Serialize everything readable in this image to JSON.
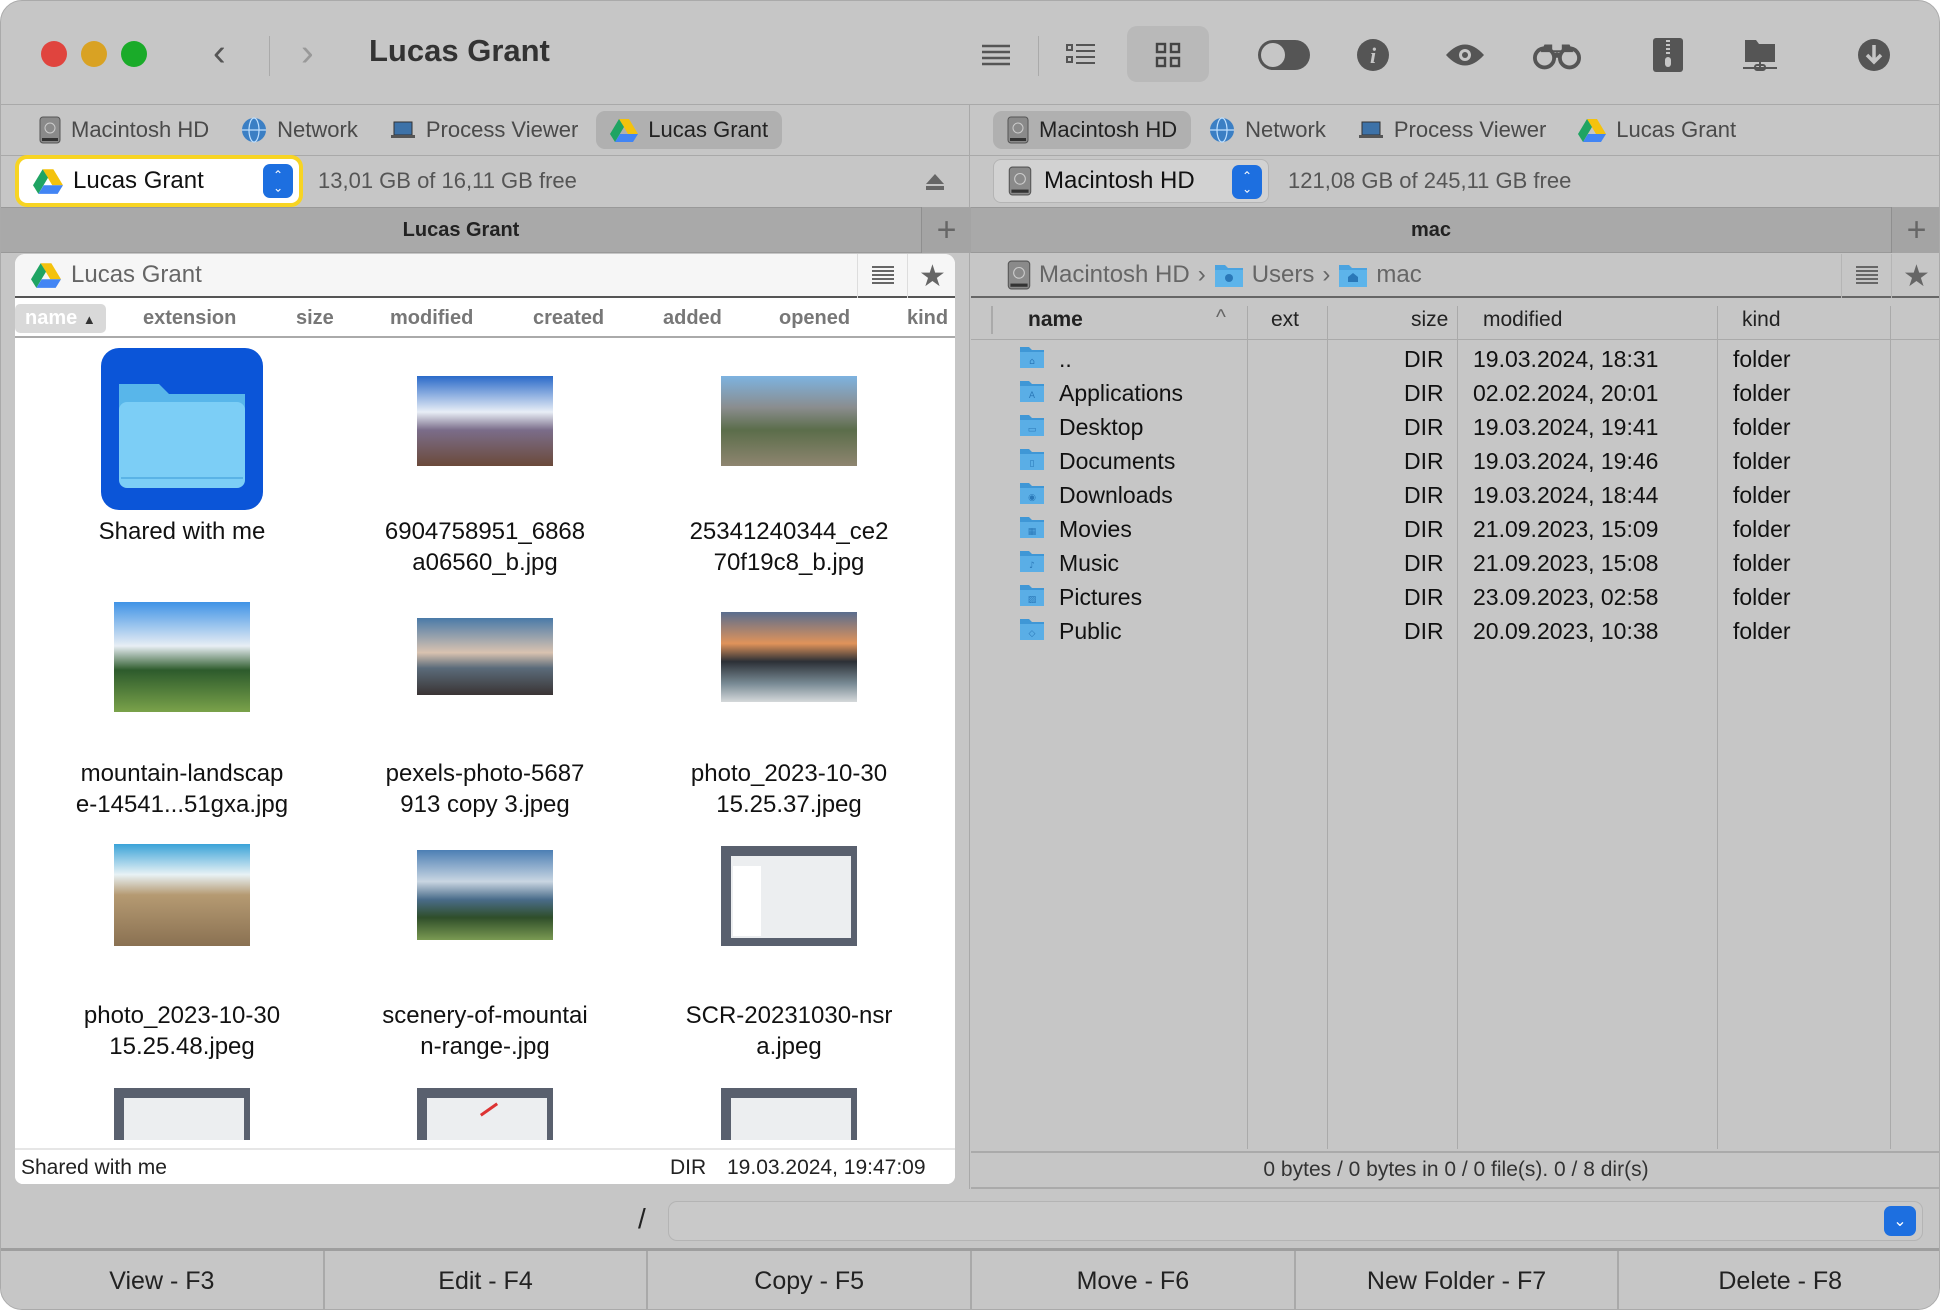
{
  "window": {
    "title": "Lucas Grant"
  },
  "toolbar": {
    "icons": [
      "brief-list-icon",
      "detailed-list-icon",
      "thumbnails-icon",
      "toggle-hidden-icon",
      "info-icon",
      "quick-look-icon",
      "search-binoculars-icon",
      "archive-zip-icon",
      "network-folder-icon",
      "download-icon"
    ],
    "active_view": "thumbnails"
  },
  "left": {
    "tabs": [
      {
        "label": "Macintosh HD",
        "icon": "hard-drive-icon"
      },
      {
        "label": "Network",
        "icon": "network-globe-icon"
      },
      {
        "label": "Process Viewer",
        "icon": "laptop-icon"
      },
      {
        "label": "Lucas Grant",
        "icon": "google-drive-icon",
        "active": true
      }
    ],
    "drive": {
      "label": "Lucas Grant",
      "free": "13,01 GB of 16,11 GB free"
    },
    "pane_title": "Lucas Grant",
    "breadcrumb": "Lucas Grant",
    "columns": [
      "name",
      "extension",
      "size",
      "modified",
      "created",
      "added",
      "opened",
      "kind"
    ],
    "sort_column": "name",
    "items": [
      {
        "name1": "Shared with me",
        "name2": "",
        "kind": "folder"
      },
      {
        "name1": "6904758951_6868",
        "name2": "a06560_b.jpg",
        "kind": "image"
      },
      {
        "name1": "25341240344_ce2",
        "name2": "70f19c8_b.jpg",
        "kind": "image"
      },
      {
        "name1": "mountain-landscap",
        "name2": "e-14541...51gxa.jpg",
        "kind": "image"
      },
      {
        "name1": "pexels-photo-5687",
        "name2": "913 copy 3.jpeg",
        "kind": "image"
      },
      {
        "name1": "photo_2023-10-30",
        "name2": "15.25.37.jpeg",
        "kind": "image"
      },
      {
        "name1": "photo_2023-10-30",
        "name2": "15.25.48.jpeg",
        "kind": "image"
      },
      {
        "name1": "scenery-of-mountai",
        "name2": "n-range-.jpg",
        "kind": "image"
      },
      {
        "name1": "SCR-20231030-nsr",
        "name2": "a.jpeg",
        "kind": "image"
      }
    ],
    "status": {
      "name": "Shared with me",
      "type": "DIR",
      "date": "19.03.2024, 19:47:09"
    }
  },
  "right": {
    "tabs": [
      {
        "label": "Macintosh HD",
        "icon": "hard-drive-icon",
        "active": true
      },
      {
        "label": "Network",
        "icon": "network-globe-icon"
      },
      {
        "label": "Process Viewer",
        "icon": "laptop-icon"
      },
      {
        "label": "Lucas Grant",
        "icon": "google-drive-icon"
      }
    ],
    "drive": {
      "label": "Macintosh HD",
      "free": "121,08 GB of 245,11 GB free"
    },
    "pane_title": "mac",
    "breadcrumb": [
      "Macintosh HD",
      "Users",
      "mac"
    ],
    "columns": {
      "name": "name",
      "ext": "ext",
      "size": "size",
      "modified": "modified",
      "kind": "kind"
    },
    "rows": [
      {
        "name": "..",
        "size": "DIR",
        "modified": "19.03.2024, 18:31",
        "kind": "folder"
      },
      {
        "name": "Applications",
        "size": "DIR",
        "modified": "02.02.2024, 20:01",
        "kind": "folder"
      },
      {
        "name": "Desktop",
        "size": "DIR",
        "modified": "19.03.2024, 19:41",
        "kind": "folder"
      },
      {
        "name": "Documents",
        "size": "DIR",
        "modified": "19.03.2024, 19:46",
        "kind": "folder"
      },
      {
        "name": "Downloads",
        "size": "DIR",
        "modified": "19.03.2024, 18:44",
        "kind": "folder"
      },
      {
        "name": "Movies",
        "size": "DIR",
        "modified": "21.09.2023, 15:09",
        "kind": "folder"
      },
      {
        "name": "Music",
        "size": "DIR",
        "modified": "21.09.2023, 15:08",
        "kind": "folder"
      },
      {
        "name": "Pictures",
        "size": "DIR",
        "modified": "23.09.2023, 02:58",
        "kind": "folder"
      },
      {
        "name": "Public",
        "size": "DIR",
        "modified": "20.09.2023, 10:38",
        "kind": "folder"
      }
    ],
    "status": "0 bytes / 0 bytes in 0 / 0 file(s). 0 / 8 dir(s)"
  },
  "command_line": {
    "prompt": "/",
    "value": ""
  },
  "fkeys": [
    "View - F3",
    "Edit - F4",
    "Copy - F5",
    "Move - F6",
    "New Folder - F7",
    "Delete - F8"
  ],
  "colors": {
    "accent": "#1d6fe0",
    "focus_ring": "#f7d423",
    "close": "#e0443e",
    "minimize": "#d9a223",
    "zoom": "#1aab29"
  }
}
